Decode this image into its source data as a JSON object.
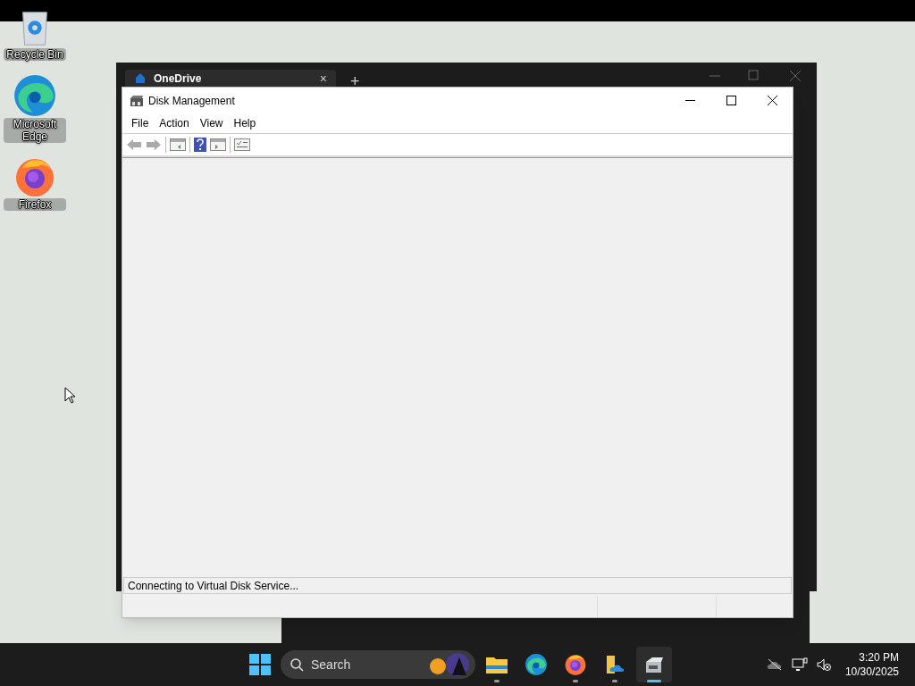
{
  "desktop_icons": [
    {
      "kind": "recycle",
      "label": "Recycle Bin"
    },
    {
      "kind": "edge",
      "label": "Microsoft Edge"
    },
    {
      "kind": "firefox",
      "label": "Firefox"
    }
  ],
  "background_window": {
    "tab_title": "OneDrive",
    "tab_close": "×",
    "new_tab": "+"
  },
  "window": {
    "title": "Disk Management",
    "menu": [
      "File",
      "Action",
      "View",
      "Help"
    ],
    "status_text": "Connecting to Virtual Disk Service..."
  },
  "taskbar": {
    "search_placeholder": "Search",
    "apps": [
      {
        "kind": "folder",
        "running": true,
        "active": false
      },
      {
        "kind": "edge",
        "running": false,
        "active": false
      },
      {
        "kind": "firefox",
        "running": true,
        "active": false
      },
      {
        "kind": "onedrive-folder",
        "running": true,
        "active": false
      },
      {
        "kind": "disk",
        "running": true,
        "active": true
      }
    ],
    "time": "3:20 PM",
    "date": "10/30/2025"
  }
}
